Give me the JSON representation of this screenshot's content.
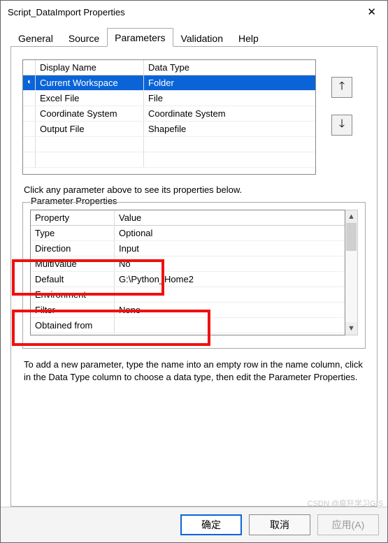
{
  "window": {
    "title": "Script_DataImport Properties",
    "close": "✕"
  },
  "tabs": {
    "general": "General",
    "source": "Source",
    "parameters": "Parameters",
    "validation": "Validation",
    "help": "Help"
  },
  "params_table": {
    "headers": {
      "display": "Display Name",
      "datatype": "Data Type"
    },
    "rows": [
      {
        "marker": "◐",
        "display": "Current Workspace",
        "datatype": "Folder",
        "selected": true
      },
      {
        "marker": "",
        "display": "Excel File",
        "datatype": "File"
      },
      {
        "marker": "",
        "display": "Coordinate System",
        "datatype": "Coordinate System"
      },
      {
        "marker": "",
        "display": "Output File",
        "datatype": "Shapefile"
      }
    ]
  },
  "hint": "Click any parameter above to see its properties below.",
  "props": {
    "legend": "Parameter Properties",
    "headers": {
      "prop": "Property",
      "value": "Value"
    },
    "rows": [
      {
        "prop": "Type",
        "value": "Optional"
      },
      {
        "prop": "Direction",
        "value": "Input"
      },
      {
        "prop": "MultiValue",
        "value": "No"
      },
      {
        "prop": "Default",
        "value": "G:\\Python_Home2"
      },
      {
        "prop": "Environment",
        "value": ""
      },
      {
        "prop": "Filter",
        "value": "None"
      },
      {
        "prop": "Obtained from",
        "value": ""
      }
    ]
  },
  "bottomhint": "To add a new parameter, type the name into an empty row in the name column, click in the Data Type column to choose a data type, then edit the Parameter Properties.",
  "buttons": {
    "ok": "确定",
    "cancel": "取消",
    "apply": "应用(A)"
  },
  "watermark": "CSDN @疯狂学习GIS"
}
